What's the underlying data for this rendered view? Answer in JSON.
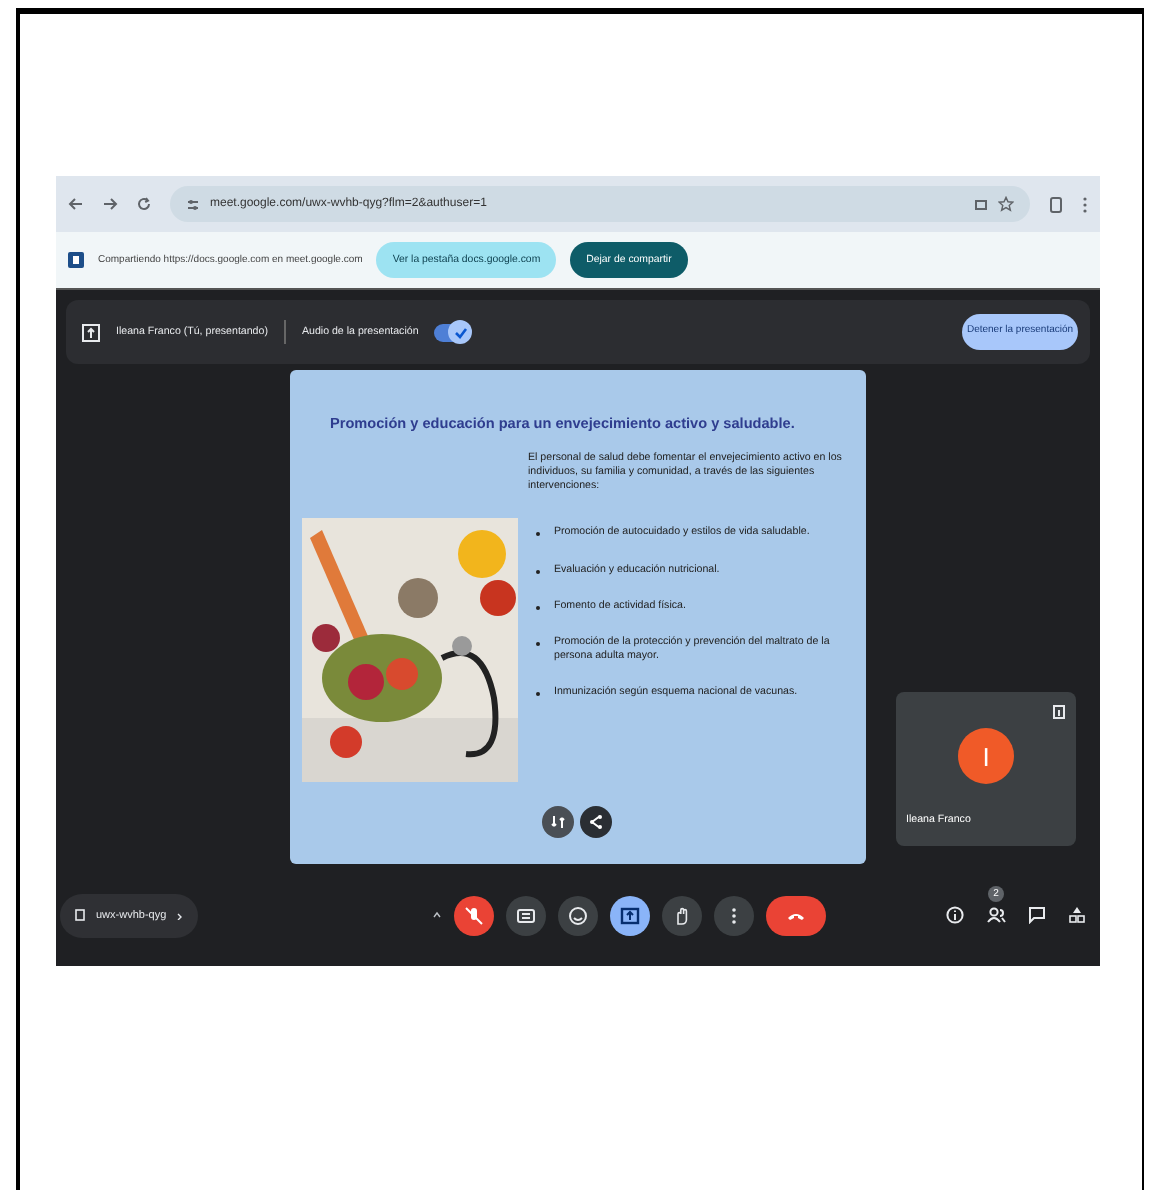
{
  "browser": {
    "url": "meet.google.com/uwx-wvhb-qyg?flm=2&authuser=1"
  },
  "share_bar": {
    "text": "Compartiendo https://docs.google.com en meet.google.com",
    "buttons": [
      {
        "label": "Ver la pestaña docs.google.com",
        "kind": "secondary"
      },
      {
        "label": "Dejar de compartir",
        "kind": "primary"
      }
    ]
  },
  "presenter_bar": {
    "presenter": "Ileana Franco (Tú, presentando)",
    "audio_label": "Audio de la presentación",
    "audio_on": true,
    "stop_button": "Detener la presentación"
  },
  "slide": {
    "title": "Promoción y educación para un envejecimiento activo y saludable.",
    "intro": "El personal de salud debe fomentar el envejecimiento activo en los individuos, su familia y comunidad, a través de las siguientes intervenciones:",
    "bullets": [
      "Promoción de autocuidado y estilos de vida saludable.",
      "Evaluación y educación nutricional.",
      "Fomento de actividad física.",
      "Promoción de la protección y prevención del maltrato de la persona adulta mayor.",
      "Inmunización según esquema nacional de vacunas."
    ]
  },
  "tile": {
    "initial": "I",
    "name": "Ileana Franco"
  },
  "meeting_code": "uwx-wvhb-qyg",
  "controls": [
    {
      "kind": "mic-off"
    },
    {
      "kind": "captions"
    },
    {
      "kind": "emoji"
    },
    {
      "kind": "present"
    },
    {
      "kind": "hand"
    },
    {
      "kind": "more"
    },
    {
      "kind": "leave"
    }
  ],
  "people_count": "2"
}
